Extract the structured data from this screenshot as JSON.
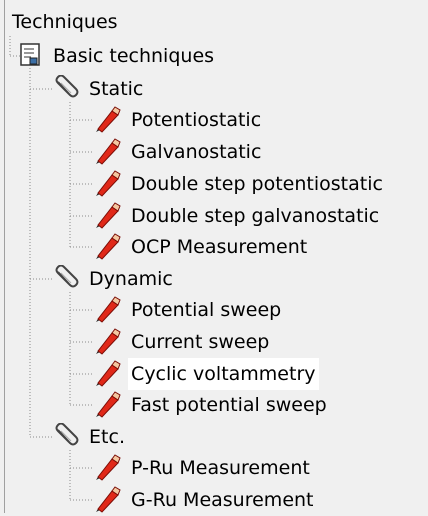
{
  "tree": {
    "root": "Techniques",
    "group": "Basic techniques",
    "categories": [
      {
        "label": "Static",
        "icon": "paperclip-icon",
        "items": [
          "Potentiostatic",
          "Galvanostatic",
          "Double step potentiostatic",
          "Double step galvanostatic",
          "OCP Measurement"
        ]
      },
      {
        "label": "Dynamic",
        "icon": "paperclip-icon",
        "items": [
          "Potential sweep",
          "Current sweep",
          "Cyclic voltammetry",
          "Fast potential sweep"
        ]
      },
      {
        "label": "Etc.",
        "icon": "paperclip-icon",
        "items": [
          "P-Ru Measurement",
          "G-Ru Measurement"
        ]
      }
    ],
    "selected": "Cyclic voltammetry",
    "item_icon": "pencil-icon",
    "group_icon": "document-icon"
  }
}
